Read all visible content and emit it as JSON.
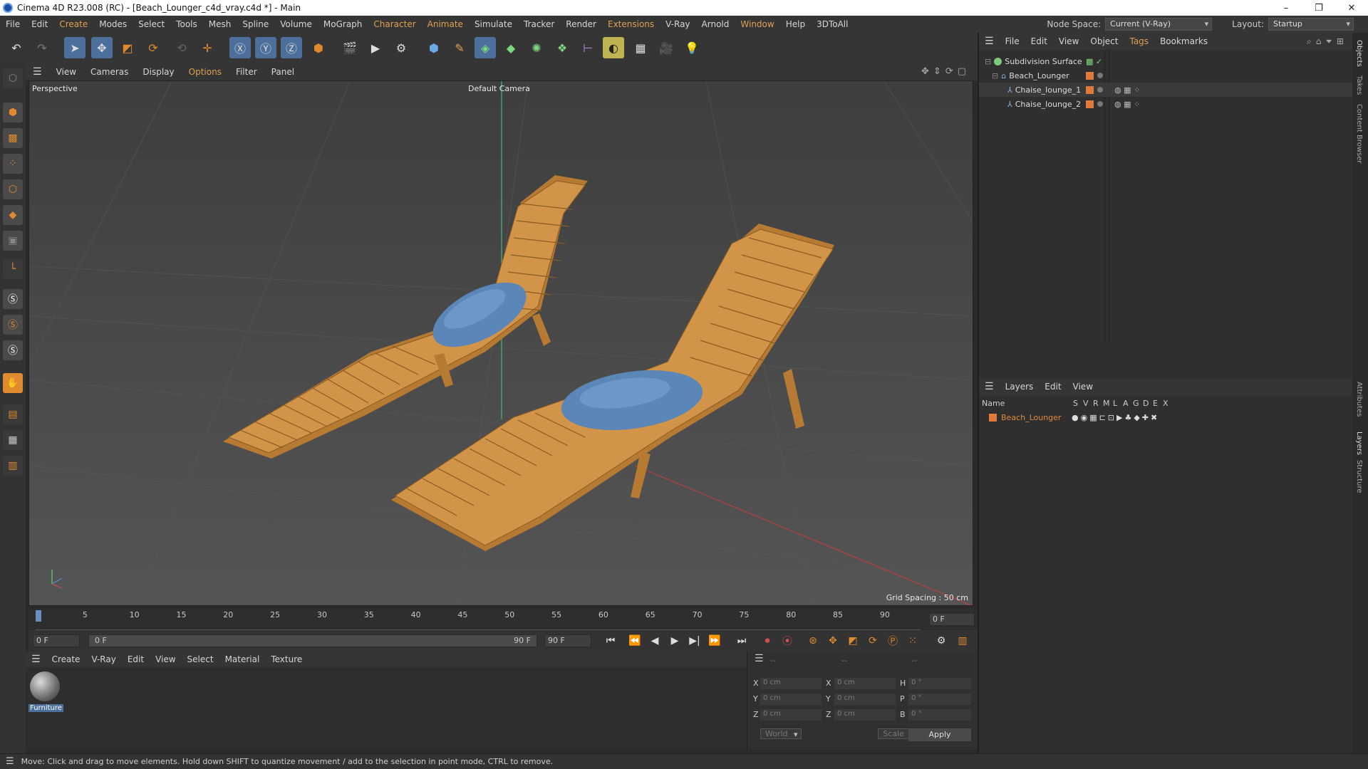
{
  "window": {
    "title": "Cinema 4D R23.008 (RC) - [Beach_Lounger_c4d_vray.c4d *] - Main",
    "min": "–",
    "max": "❐",
    "close": "✕"
  },
  "menubar": {
    "items": [
      "File",
      "Edit",
      "Create",
      "Modes",
      "Select",
      "Tools",
      "Mesh",
      "Spline",
      "Volume",
      "MoGraph",
      "Character",
      "Animate",
      "Simulate",
      "Tracker",
      "Render",
      "Extensions",
      "V-Ray",
      "Arnold",
      "Window",
      "Help",
      "3DToAll"
    ],
    "node_space_label": "Node Space:",
    "node_space_value": "Current (V-Ray)",
    "layout_label": "Layout:",
    "layout_value": "Startup"
  },
  "viewport_menu": {
    "items": [
      "View",
      "Cameras",
      "Display",
      "Options",
      "Filter",
      "Panel"
    ]
  },
  "viewport": {
    "name": "Perspective",
    "camera": "Default Camera",
    "grid_spacing": "Grid Spacing : 50 cm"
  },
  "timeline": {
    "ticks": [
      "0",
      "5",
      "10",
      "15",
      "20",
      "25",
      "30",
      "35",
      "40",
      "45",
      "50",
      "55",
      "60",
      "65",
      "70",
      "75",
      "80",
      "85",
      "90"
    ],
    "current_frame": "0 F",
    "start_frame": "0 F",
    "range_start": "0 F",
    "range_end": "90 F",
    "end_frame": "90 F"
  },
  "material_manager": {
    "menu": [
      "Create",
      "V-Ray",
      "Edit",
      "View",
      "Select",
      "Material",
      "Texture"
    ],
    "materials": [
      {
        "name": "Furniture"
      }
    ]
  },
  "coordinates": {
    "header_left": "--",
    "header_mid": "--",
    "header_right": "--",
    "rows": [
      {
        "a": "X",
        "av": "0 cm",
        "b": "X",
        "bv": "0 cm",
        "c": "H",
        "cv": "0 °"
      },
      {
        "a": "Y",
        "av": "0 cm",
        "b": "Y",
        "bv": "0 cm",
        "c": "P",
        "cv": "0 °"
      },
      {
        "a": "Z",
        "av": "0 cm",
        "b": "Z",
        "bv": "0 cm",
        "c": "B",
        "cv": "0 °"
      }
    ],
    "space": "World",
    "mode": "Scale",
    "apply": "Apply"
  },
  "object_manager": {
    "menu": [
      "File",
      "Edit",
      "View",
      "Object",
      "Tags",
      "Bookmarks"
    ],
    "objects": [
      {
        "name": "Subdivision Surface",
        "color": "#7dc97d"
      },
      {
        "name": "Beach_Lounger",
        "color": "#e07a3a"
      },
      {
        "name": "Chaise_lounge_1",
        "color": "#e07a3a"
      },
      {
        "name": "Chaise_lounge_2",
        "color": "#e07a3a"
      }
    ]
  },
  "layer_manager": {
    "menu": [
      "Layers",
      "Edit",
      "View"
    ],
    "columns": [
      "Name",
      "S",
      "V",
      "R",
      "M",
      "L",
      "A",
      "G",
      "D",
      "E",
      "X"
    ],
    "layers": [
      {
        "name": "Beach_Lounger",
        "color": "#e07a3a"
      }
    ]
  },
  "side_tabs": [
    "Objects",
    "Takes",
    "Content Browser",
    "Attributes",
    "Layers",
    "Structure"
  ],
  "status": "Move: Click and drag to move elements. Hold down SHIFT to quantize movement / add to the selection in point mode, CTRL to remove.",
  "colors": {
    "accent_orange": "#e0a050",
    "selection_blue": "#4c6f9c",
    "wood": "#c98a3c",
    "pillow": "#5b86b8"
  }
}
